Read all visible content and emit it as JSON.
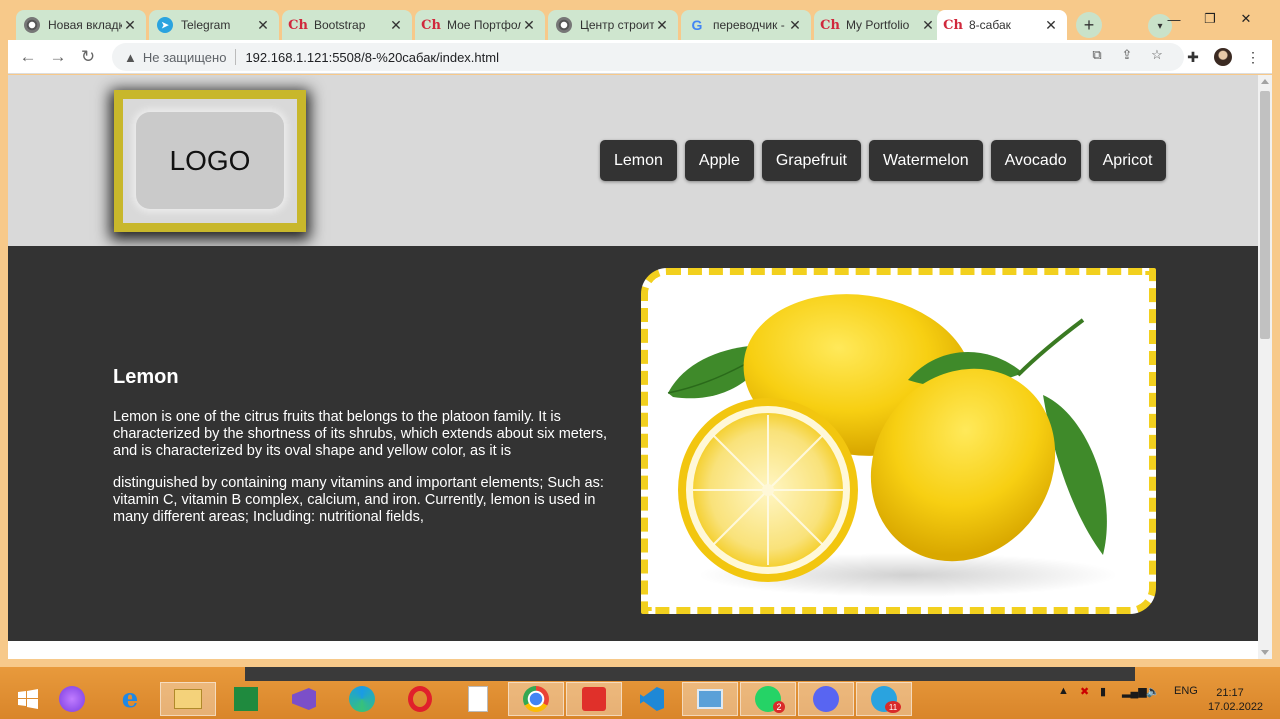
{
  "browser": {
    "tabs": [
      {
        "title": "Новая вкладк",
        "icon": "chrome-icon",
        "active": false
      },
      {
        "title": "Telegram",
        "icon": "telegram-icon",
        "active": false
      },
      {
        "title": "Bootstrap",
        "icon": "ch-icon",
        "active": false
      },
      {
        "title": "Мое Портфол",
        "icon": "ch-icon",
        "active": false
      },
      {
        "title": "Центр строит",
        "icon": "chrome-icon",
        "active": false
      },
      {
        "title": "переводчик -",
        "icon": "google-icon",
        "active": false
      },
      {
        "title": "My Portfolio",
        "icon": "ch-icon",
        "active": false
      },
      {
        "title": "8-сабак",
        "icon": "ch-icon",
        "active": true
      }
    ],
    "security_label": "Не защищено",
    "url": "192.168.1.121:5508/8-%20сабак/index.html"
  },
  "site": {
    "logo_text": "LOGO",
    "nav": [
      "Lemon",
      "Apple",
      "Grapefruit",
      "Watermelon",
      "Avocado",
      "Apricot"
    ],
    "hero": {
      "title": "Lemon",
      "paragraph1": "Lemon is one of the citrus fruits that belongs to the platoon family. It is characterized by the shortness of its shrubs, which extends about six meters, and is characterized by its oval shape and yellow color, as it is",
      "paragraph2": "distinguished by containing many vitamins and important elements; Such as: vitamin C, vitamin B complex, calcium, and iron. Currently, lemon is used in many different areas; Including: nutritional fields,"
    }
  },
  "taskbar": {
    "whatsapp_badge": "2",
    "telegram_badge": "11",
    "language": "ENG",
    "time": "21:17",
    "date": "17.02.2022"
  },
  "colors": {
    "tab_inactive": "#cfe6cf",
    "header_bg": "#d9d9d9",
    "hero_bg": "#333333",
    "logo_border": "#c8b72b",
    "image_border": "#f2d01e",
    "taskbar": "#e89a3c"
  }
}
